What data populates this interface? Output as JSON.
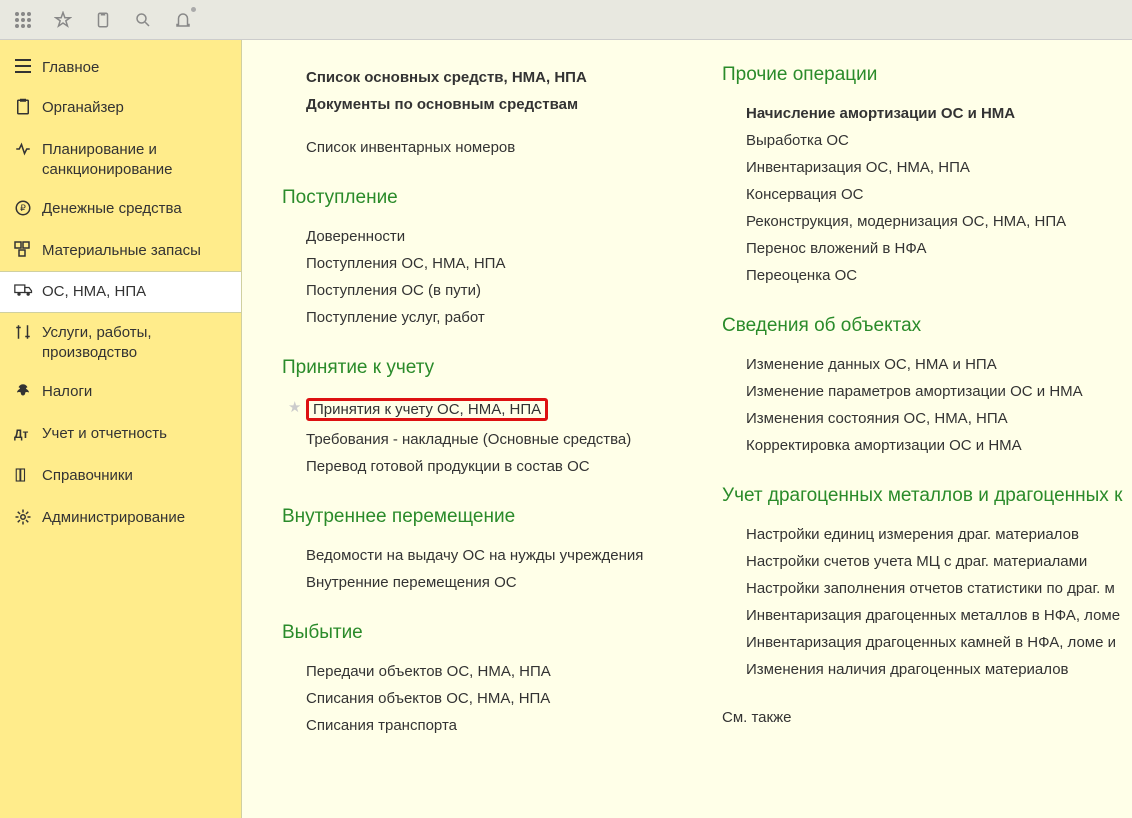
{
  "topbar": {
    "apps_icon": "apps-icon",
    "star_icon": "star-icon",
    "clipboard_icon": "clipboard-icon",
    "search_icon": "search-icon",
    "bell_icon": "bell-icon"
  },
  "sidebar": {
    "items": [
      {
        "label": "Главное",
        "icon": "menu"
      },
      {
        "label": "Органайзер",
        "icon": "clipboard"
      },
      {
        "label": "Планирование и санкционирование",
        "icon": "plan"
      },
      {
        "label": "Денежные средства",
        "icon": "ruble"
      },
      {
        "label": "Материальные запасы",
        "icon": "boxes"
      },
      {
        "label": "ОС, НМА, НПА",
        "icon": "truck"
      },
      {
        "label": "Услуги, работы, производство",
        "icon": "tools"
      },
      {
        "label": "Налоги",
        "icon": "eagle"
      },
      {
        "label": "Учет и отчетность",
        "icon": "report"
      },
      {
        "label": "Справочники",
        "icon": "books"
      },
      {
        "label": "Администрирование",
        "icon": "gear"
      }
    ],
    "active_index": 5
  },
  "content": {
    "col1_top": [
      "Список основных средств, НМА, НПА",
      "Документы по основным средствам",
      "",
      "Список инвентарных номеров"
    ],
    "sections_left": [
      {
        "title": "Поступление",
        "items": [
          "Доверенности",
          "Поступления ОС, НМА, НПА",
          "Поступления ОС (в пути)",
          "Поступление услуг, работ"
        ]
      },
      {
        "title": "Принятие к учету",
        "items": [
          "Принятия к учету ОС, НМА, НПА",
          "Требования - накладные (Основные средства)",
          "Перевод готовой продукции в состав ОС"
        ],
        "highlight_index": 0
      },
      {
        "title": "Внутреннее перемещение",
        "items": [
          "Ведомости на выдачу ОС на нужды учреждения",
          "Внутренние перемещения ОС"
        ]
      },
      {
        "title": "Выбытие",
        "items": [
          "Передачи объектов ОС, НМА, НПА",
          "Списания объектов ОС, НМА, НПА",
          "Списания транспорта"
        ]
      }
    ],
    "sections_right": [
      {
        "title": "Прочие операции",
        "items": [
          "Начисление амортизации ОС и НМА",
          "Выработка ОС",
          "Инвентаризация ОС, НМА, НПА",
          "Консервация ОС",
          "Реконструкция, модернизация ОС, НМА, НПА",
          "Перенос вложений в НФА",
          "Переоценка ОС"
        ],
        "bold_index": 0
      },
      {
        "title": "Сведения об объектах",
        "items": [
          "Изменение данных ОС, НМА и НПА",
          "Изменение параметров амортизации ОС и НМА",
          "Изменения состояния ОС, НМА, НПА",
          "Корректировка амортизации ОС и НМА"
        ]
      },
      {
        "title": "Учет драгоценных металлов и драгоценных к",
        "items": [
          "Настройки единиц измерения драг. материалов",
          "Настройки счетов учета МЦ с драг. материалами",
          "Настройки заполнения отчетов статистики по драг. м",
          "Инвентаризация драгоценных металлов в НФА, ломе",
          "Инвентаризация драгоценных камней в НФА, ломе и",
          "Изменения наличия драгоценных материалов"
        ]
      }
    ],
    "footnote": "См. также"
  }
}
